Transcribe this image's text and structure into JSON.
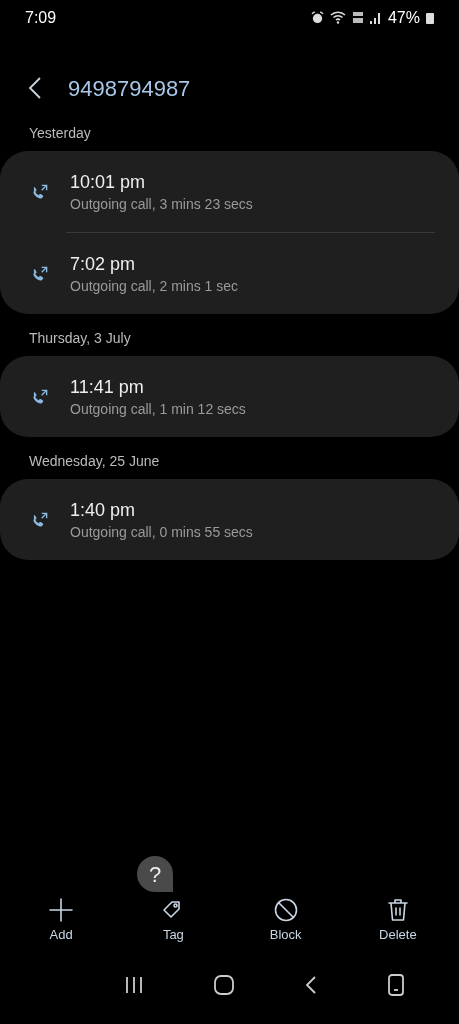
{
  "status_bar": {
    "time": "7:09",
    "battery": "47%"
  },
  "header": {
    "title": "9498794987"
  },
  "groups": [
    {
      "date": "Yesterday",
      "calls": [
        {
          "time": "10:01 pm",
          "detail": "Outgoing call, 3 mins 23 secs"
        },
        {
          "time": "7:02 pm",
          "detail": "Outgoing call, 2 mins 1 sec"
        }
      ]
    },
    {
      "date": "Thursday, 3 July",
      "calls": [
        {
          "time": "11:41 pm",
          "detail": "Outgoing call, 1 min 12 secs"
        }
      ]
    },
    {
      "date": "Wednesday, 25 June",
      "calls": [
        {
          "time": "1:40 pm",
          "detail": "Outgoing call, 0 mins 55 secs"
        }
      ]
    }
  ],
  "help_bubble": "?",
  "actions": [
    {
      "kind": "add",
      "label": "Add"
    },
    {
      "kind": "tag",
      "label": "Tag"
    },
    {
      "kind": "block",
      "label": "Block"
    },
    {
      "kind": "delete",
      "label": "Delete"
    }
  ]
}
